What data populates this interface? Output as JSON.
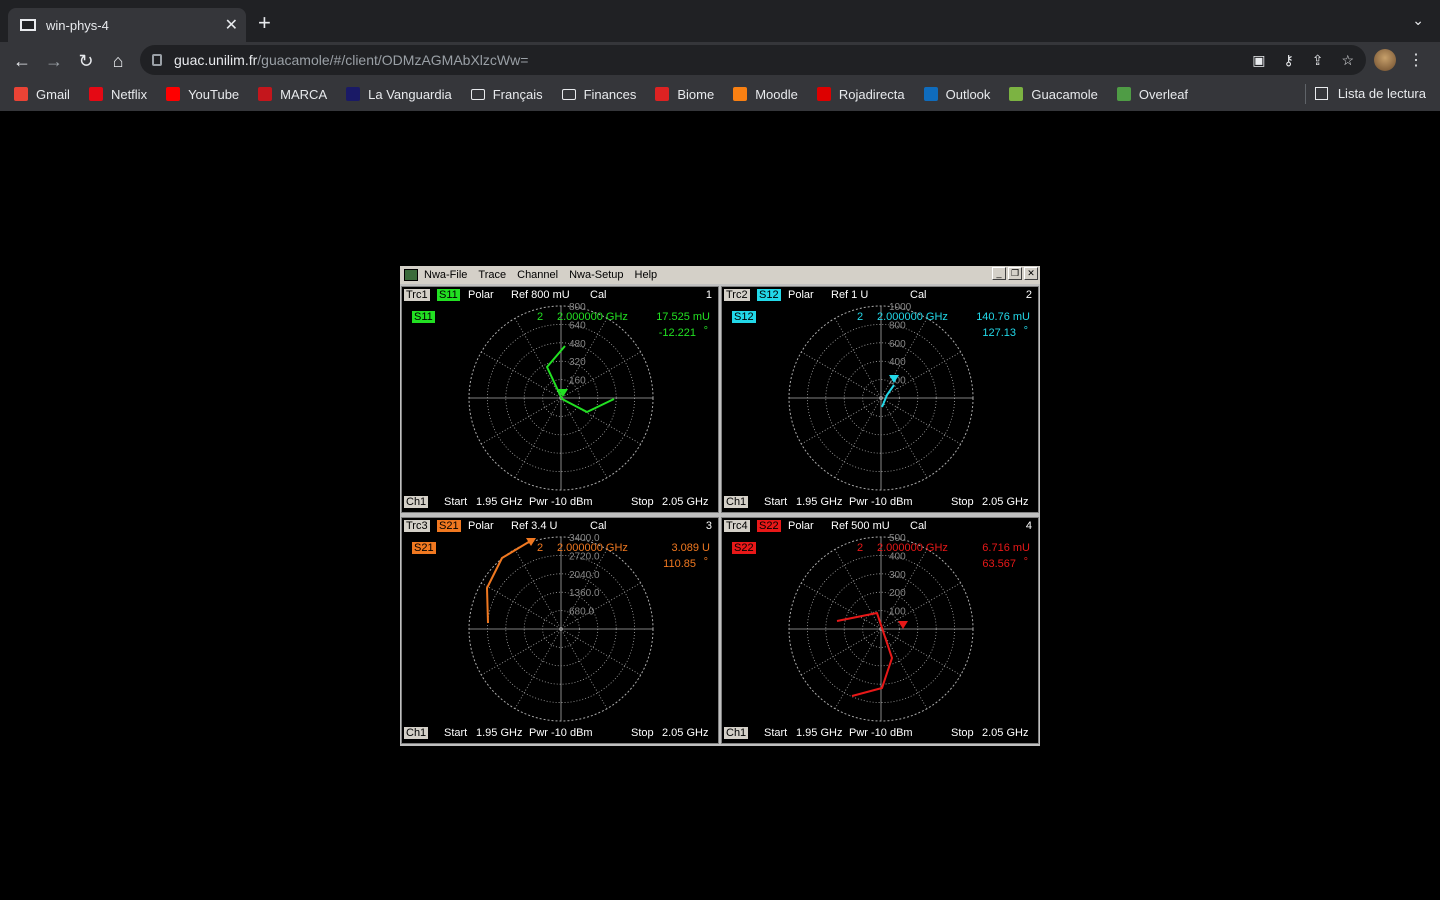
{
  "browser": {
    "tab_title": "win-phys-4",
    "url_host": "guac.unilim.fr",
    "url_path": "/guacamole/#/client/ODMzAGMAbXlzcWw=",
    "bookmarks": [
      {
        "label": "Gmail",
        "color": "#ea4335"
      },
      {
        "label": "Netflix",
        "color": "#e50914"
      },
      {
        "label": "YouTube",
        "color": "#ff0000"
      },
      {
        "label": "MARCA",
        "color": "#c4161c"
      },
      {
        "label": "La Vanguardia",
        "color": "#1a1a66"
      },
      {
        "label": "Français",
        "color": "folder"
      },
      {
        "label": "Finances",
        "color": "folder"
      },
      {
        "label": "Biome",
        "color": "#d22"
      },
      {
        "label": "Moodle",
        "color": "#f98012"
      },
      {
        "label": "Rojadirecta",
        "color": "#d00"
      },
      {
        "label": "Outlook",
        "color": "#0f6cbd"
      },
      {
        "label": "Guacamole",
        "color": "#7cb342"
      },
      {
        "label": "Overleaf",
        "color": "#4f9c45"
      }
    ],
    "reading_list": "Lista de lectura"
  },
  "vna": {
    "menu": [
      "Nwa-File",
      "Trace",
      "Channel",
      "Nwa-Setup",
      "Help"
    ],
    "traces": [
      {
        "trc": "Trc1",
        "param": "S11",
        "format": "Polar",
        "ref": "Ref 800 mU",
        "cal": "Cal",
        "num": "1",
        "color": "#22e022",
        "marker_no": "2",
        "marker_freq": "2.000000 GHz",
        "marker_mag": "17.525 mU",
        "marker_phase": "-12.221",
        "deg": "°",
        "ticks": [
          "800",
          "640",
          "480",
          "320",
          "160"
        ],
        "ch": "Ch1",
        "start_label": "Start",
        "start": "1.95 GHz",
        "pwr": "Pwr -10 dBm",
        "stop_label": "Stop",
        "stop": "2.05 GHz"
      },
      {
        "trc": "Trc2",
        "param": "S12",
        "format": "Polar",
        "ref": "Ref 1 U",
        "cal": "Cal",
        "num": "2",
        "color": "#22d8e8",
        "marker_no": "2",
        "marker_freq": "2.000000 GHz",
        "marker_mag": "140.76 mU",
        "marker_phase": "127.13",
        "deg": "°",
        "ticks": [
          "1000",
          "800",
          "600",
          "400",
          "200"
        ],
        "ch": "Ch1",
        "start_label": "Start",
        "start": "1.95 GHz",
        "pwr": "Pwr -10 dBm",
        "stop_label": "Stop",
        "stop": "2.05 GHz"
      },
      {
        "trc": "Trc3",
        "param": "S21",
        "format": "Polar",
        "ref": "Ref 3.4 U",
        "cal": "Cal",
        "num": "3",
        "color": "#f07820",
        "marker_no": "2",
        "marker_freq": "2.000000 GHz",
        "marker_mag": "3.089 U",
        "marker_phase": "110.85",
        "deg": "°",
        "ticks": [
          "3400.0",
          "2720.0",
          "2040.0",
          "1360.0",
          "680.0"
        ],
        "ch": "Ch1",
        "start_label": "Start",
        "start": "1.95 GHz",
        "pwr": "Pwr -10 dBm",
        "stop_label": "Stop",
        "stop": "2.05 GHz"
      },
      {
        "trc": "Trc4",
        "param": "S22",
        "format": "Polar",
        "ref": "Ref 500 mU",
        "cal": "Cal",
        "num": "4",
        "color": "#e81818",
        "marker_no": "2",
        "marker_freq": "2.000000 GHz",
        "marker_mag": "6.716 mU",
        "marker_phase": "63.567",
        "deg": "°",
        "ticks": [
          "500",
          "400",
          "300",
          "200",
          "100"
        ],
        "ch": "Ch1",
        "start_label": "Start",
        "start": "1.95 GHz",
        "pwr": "Pwr -10 dBm",
        "stop_label": "Stop",
        "stop": "2.05 GHz"
      }
    ]
  }
}
